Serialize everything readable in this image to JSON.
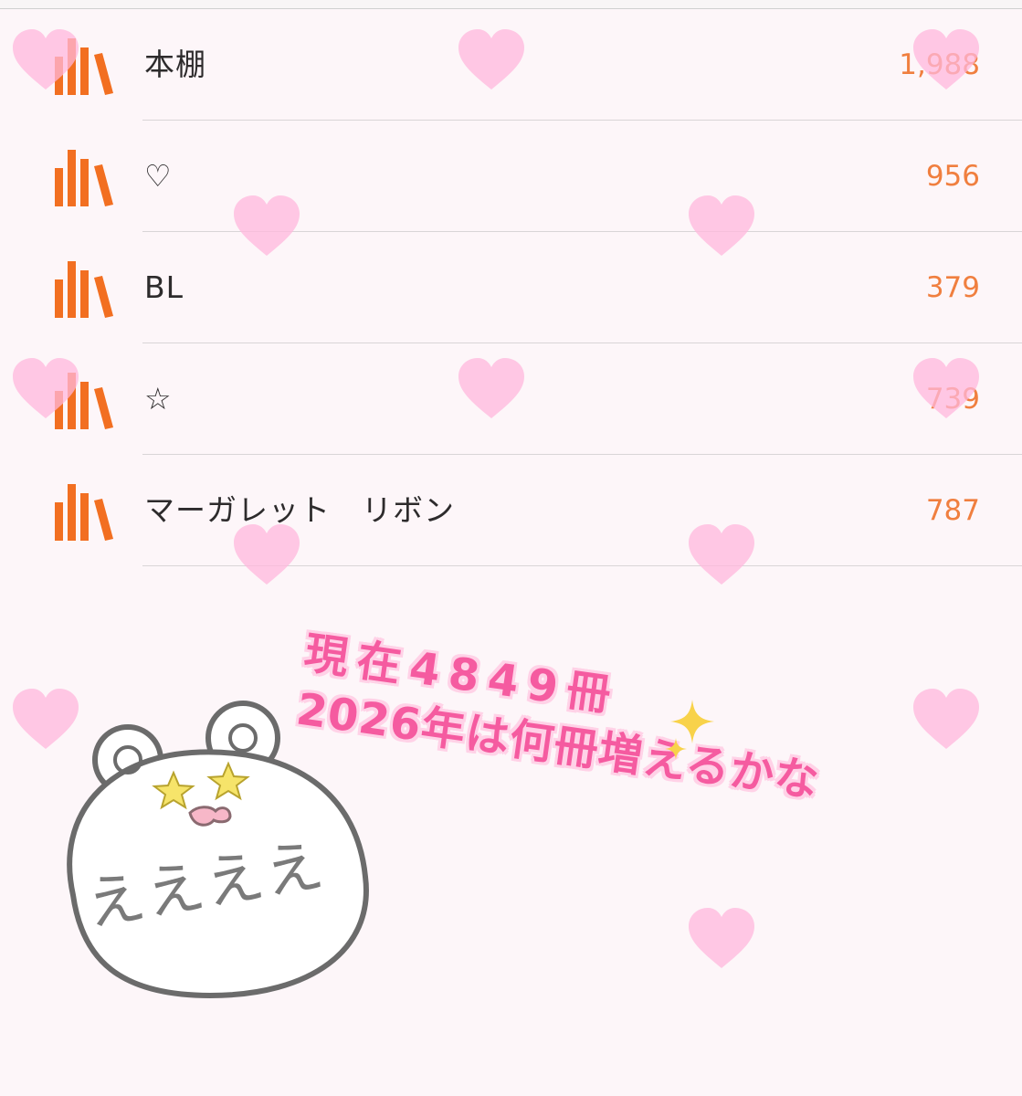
{
  "colors": {
    "accent": "#f07f3f",
    "caption_pink": "#f55ba0",
    "heart_pink": "#ffb7dc"
  },
  "shelves": [
    {
      "icon": "bookshelf-icon",
      "name": "本棚",
      "count": "1,988"
    },
    {
      "icon": "bookshelf-icon",
      "name": "♡",
      "count": "956"
    },
    {
      "icon": "bookshelf-icon",
      "name": "BL",
      "count": "379"
    },
    {
      "icon": "bookshelf-icon",
      "name": "☆",
      "count": "739"
    },
    {
      "icon": "bookshelf-icon",
      "name": "マーガレット　リボン",
      "count": "787"
    }
  ],
  "caption": {
    "line1": "現在4849冊",
    "line2": "2026年は何冊増えるかな"
  },
  "bear": {
    "icon": "bear-sticker-icon",
    "text": "ええええ"
  },
  "decorations": {
    "heart_icon": "heart-icon",
    "sparkle_icon": "sparkle-icon"
  }
}
